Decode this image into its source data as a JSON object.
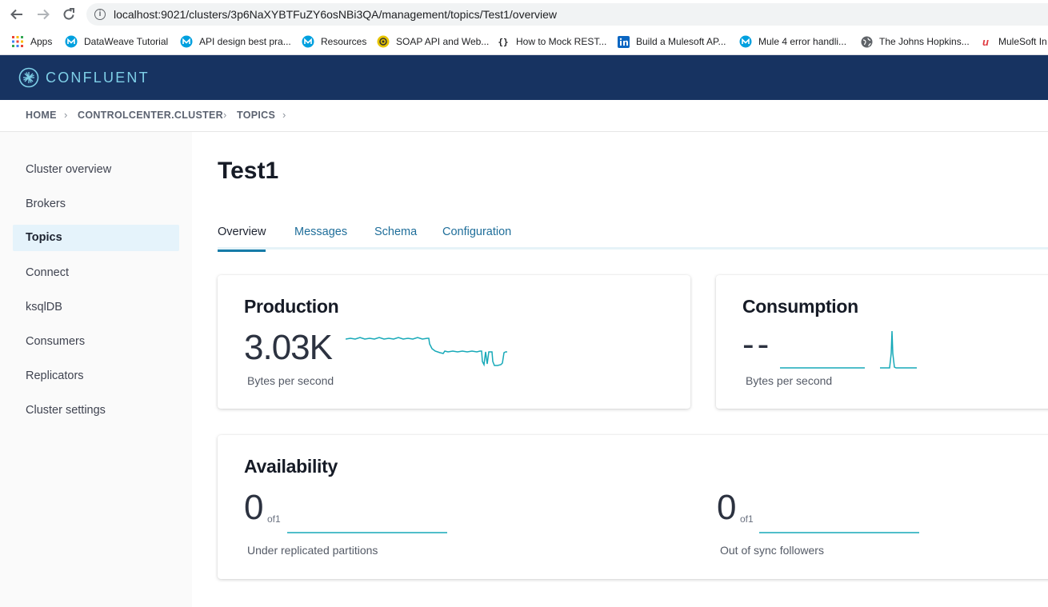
{
  "browser": {
    "url": "localhost:9021/clusters/3p6NaXYBTFuZY6osNBi3QA/management/topics/Test1/overview",
    "bookmarks": [
      {
        "label": "Apps",
        "icon": "apps-grid-icon"
      },
      {
        "label": "DataWeave Tutorial",
        "icon": "mulesoft-icon"
      },
      {
        "label": "API design best pra...",
        "icon": "mulesoft-icon"
      },
      {
        "label": "Resources",
        "icon": "mulesoft-icon"
      },
      {
        "label": "SOAP API and Web...",
        "icon": "soap-icon"
      },
      {
        "label": "How to Mock REST...",
        "icon": "braces-icon"
      },
      {
        "label": "Build a Mulesoft AP...",
        "icon": "linkedin-icon"
      },
      {
        "label": "Mule 4 error handli...",
        "icon": "mulesoft-icon"
      },
      {
        "label": "The Johns Hopkins...",
        "icon": "globe-icon"
      },
      {
        "label": "MuleSoft In",
        "icon": "mulesoft-red-icon"
      }
    ]
  },
  "brand": {
    "name": "CONFLUENT",
    "color": "#173361",
    "accent": "#7fd0e8"
  },
  "breadcrumb": [
    "HOME",
    "CONTROLCENTER.CLUSTER",
    "TOPICS"
  ],
  "sidebar": {
    "items": [
      {
        "label": "Cluster overview",
        "active": false
      },
      {
        "label": "Brokers",
        "active": false
      },
      {
        "label": "Topics",
        "active": true
      },
      {
        "label": "Connect",
        "active": false
      },
      {
        "label": "ksqlDB",
        "active": false
      },
      {
        "label": "Consumers",
        "active": false
      },
      {
        "label": "Replicators",
        "active": false
      },
      {
        "label": "Cluster settings",
        "active": false
      }
    ]
  },
  "page": {
    "title": "Test1",
    "tabs": [
      {
        "label": "Overview",
        "active": true
      },
      {
        "label": "Messages",
        "active": false
      },
      {
        "label": "Schema",
        "active": false
      },
      {
        "label": "Configuration",
        "active": false
      }
    ]
  },
  "production": {
    "title": "Production",
    "value": "3.03K",
    "unit": "Bytes per second"
  },
  "consumption": {
    "title": "Consumption",
    "value": "--",
    "unit": "Bytes per second"
  },
  "availability": {
    "title": "Availability",
    "under_replicated": {
      "value": "0",
      "of": "of1",
      "label": "Under replicated partitions"
    },
    "out_of_sync": {
      "value": "0",
      "of": "of1",
      "label": "Out of sync followers"
    }
  },
  "sparkline_color": "#17a9b8"
}
